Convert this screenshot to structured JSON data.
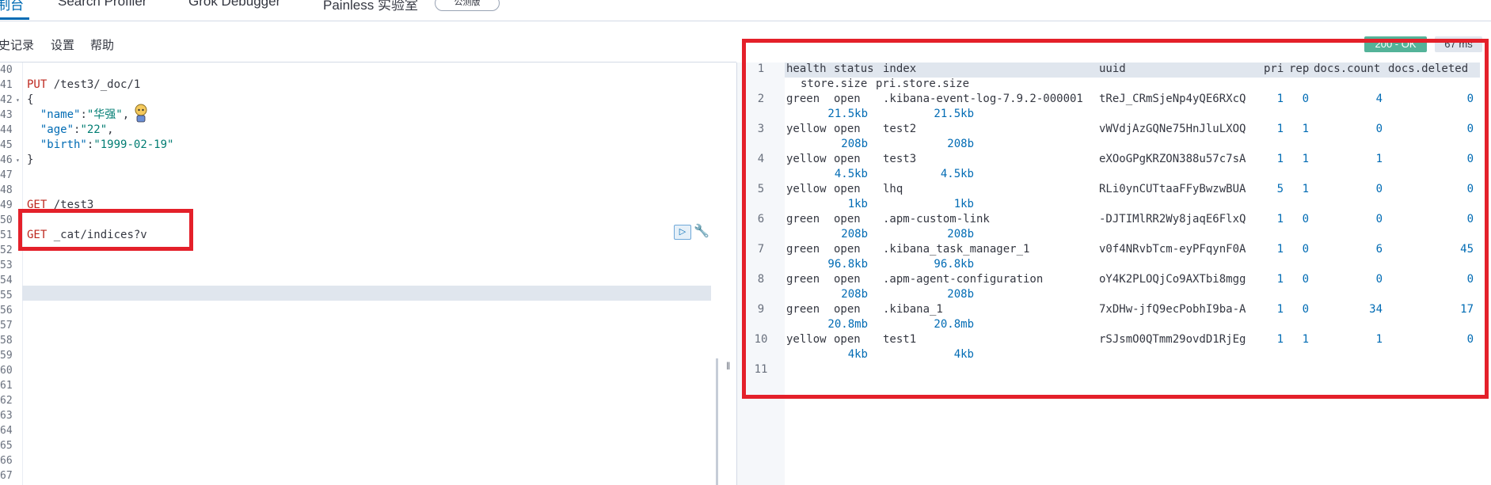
{
  "tabs": [
    {
      "label": "控制台",
      "visible_label": "制台",
      "active": true
    },
    {
      "label": "Search Profiler"
    },
    {
      "label": "Grok Debugger"
    },
    {
      "label": "Painless 实验室"
    }
  ],
  "beta_badge": "公测版",
  "toolbar": {
    "history": "历史记录",
    "visible_history": "史记录",
    "settings": "设置",
    "help": "帮助"
  },
  "editor_lines": [
    {
      "n": "40",
      "code": ""
    },
    {
      "n": "41",
      "method": "PUT",
      "url": " /test3/_doc/1"
    },
    {
      "n": "42",
      "fold": true,
      "code": "{"
    },
    {
      "n": "43",
      "indent": "  ",
      "key": "\"name\"",
      "sep": ":",
      "str": "\"华强\"",
      "tail": ","
    },
    {
      "n": "44",
      "indent": "  ",
      "key": "\"age\"",
      "sep": ":",
      "str": "\"22\"",
      "tail": ","
    },
    {
      "n": "45",
      "indent": "  ",
      "key": "\"birth\"",
      "sep": ":",
      "str": "\"1999-02-19\"",
      "tail": ""
    },
    {
      "n": "46",
      "fold": true,
      "code": "}"
    },
    {
      "n": "47",
      "code": ""
    },
    {
      "n": "48",
      "code": ""
    },
    {
      "n": "49",
      "method": "GET",
      "url": " /test3"
    },
    {
      "n": "50",
      "code": ""
    },
    {
      "n": "51",
      "method": "GET",
      "url": " _cat/indices?v"
    },
    {
      "n": "52",
      "code": ""
    },
    {
      "n": "53",
      "code": ""
    },
    {
      "n": "54",
      "code": ""
    },
    {
      "n": "55",
      "code": ""
    },
    {
      "n": "56",
      "code": ""
    },
    {
      "n": "57",
      "code": ""
    },
    {
      "n": "58",
      "code": ""
    },
    {
      "n": "59",
      "code": ""
    },
    {
      "n": "60",
      "code": ""
    },
    {
      "n": "61",
      "code": ""
    },
    {
      "n": "62",
      "code": ""
    },
    {
      "n": "63",
      "code": ""
    },
    {
      "n": "64",
      "code": ""
    },
    {
      "n": "65",
      "code": ""
    },
    {
      "n": "66",
      "code": ""
    },
    {
      "n": "67",
      "code": ""
    }
  ],
  "response": {
    "status": "200 - OK",
    "time": "67 ms",
    "header": {
      "health": "health",
      "status": "status",
      "index": "index",
      "uuid": "uuid",
      "pri": "pri",
      "rep": "rep",
      "docs_count": "docs.count",
      "docs_deleted": "docs.deleted",
      "store_size": "store.size",
      "pri_store_size": "pri.store.size"
    },
    "rows": [
      {
        "n": "2",
        "health": "green",
        "status": "open",
        "index": ".kibana-event-log-7.9.2-000001",
        "uuid": "tReJ_CRmSjeNp4yQE6RXcQ",
        "pri": "1",
        "rep": "0",
        "docs_count": "4",
        "docs_deleted": "0",
        "store_size": "21.5kb",
        "pri_store_size": "21.5kb"
      },
      {
        "n": "3",
        "health": "yellow",
        "status": "open",
        "index": "test2",
        "uuid": "vWVdjAzGQNe75HnJluLXOQ",
        "pri": "1",
        "rep": "1",
        "docs_count": "0",
        "docs_deleted": "0",
        "store_size": "208b",
        "pri_store_size": "208b"
      },
      {
        "n": "4",
        "health": "yellow",
        "status": "open",
        "index": "test3",
        "uuid": "eXOoGPgKRZON388u57c7sA",
        "pri": "1",
        "rep": "1",
        "docs_count": "1",
        "docs_deleted": "0",
        "store_size": "4.5kb",
        "pri_store_size": "4.5kb"
      },
      {
        "n": "5",
        "health": "yellow",
        "status": "open",
        "index": "lhq",
        "uuid": "RLi0ynCUTtaaFFyBwzwBUA",
        "pri": "5",
        "rep": "1",
        "docs_count": "0",
        "docs_deleted": "0",
        "store_size": "1kb",
        "pri_store_size": "1kb"
      },
      {
        "n": "6",
        "health": "green",
        "status": "open",
        "index": ".apm-custom-link",
        "uuid": "-DJTIMlRR2Wy8jaqE6FlxQ",
        "pri": "1",
        "rep": "0",
        "docs_count": "0",
        "docs_deleted": "0",
        "store_size": "208b",
        "pri_store_size": "208b"
      },
      {
        "n": "7",
        "health": "green",
        "status": "open",
        "index": ".kibana_task_manager_1",
        "uuid": "v0f4NRvbTcm-eyPFqynF0A",
        "pri": "1",
        "rep": "0",
        "docs_count": "6",
        "docs_deleted": "45",
        "store_size": "96.8kb",
        "pri_store_size": "96.8kb"
      },
      {
        "n": "8",
        "health": "green",
        "status": "open",
        "index": ".apm-agent-configuration",
        "uuid": "oY4K2PLOQjCo9AXTbi8mgg",
        "pri": "1",
        "rep": "0",
        "docs_count": "0",
        "docs_deleted": "0",
        "store_size": "208b",
        "pri_store_size": "208b"
      },
      {
        "n": "9",
        "health": "green",
        "status": "open",
        "index": ".kibana_1",
        "uuid": "7xDHw-jfQ9ecPobhI9ba-A",
        "pri": "1",
        "rep": "0",
        "docs_count": "34",
        "docs_deleted": "17",
        "store_size": "20.8mb",
        "pri_store_size": "20.8mb"
      },
      {
        "n": "10",
        "health": "yellow",
        "status": "open",
        "index": "test1",
        "uuid": "rSJsmO0QTmm29ovdD1RjEg",
        "pri": "1",
        "rep": "1",
        "docs_count": "1",
        "docs_deleted": "0",
        "store_size": "4kb",
        "pri_store_size": "4kb"
      }
    ],
    "last_line": "11"
  },
  "icons": {
    "run": "play-icon",
    "settings": "wrench-icon",
    "resize": "drag-handle-icon",
    "sticker": "anime-sticker-icon"
  },
  "colors": {
    "accent": "#006bb4",
    "ok_badge": "#54b399",
    "annotation_red": "#e4202a",
    "method": "#bd271e",
    "string": "#017d73"
  }
}
